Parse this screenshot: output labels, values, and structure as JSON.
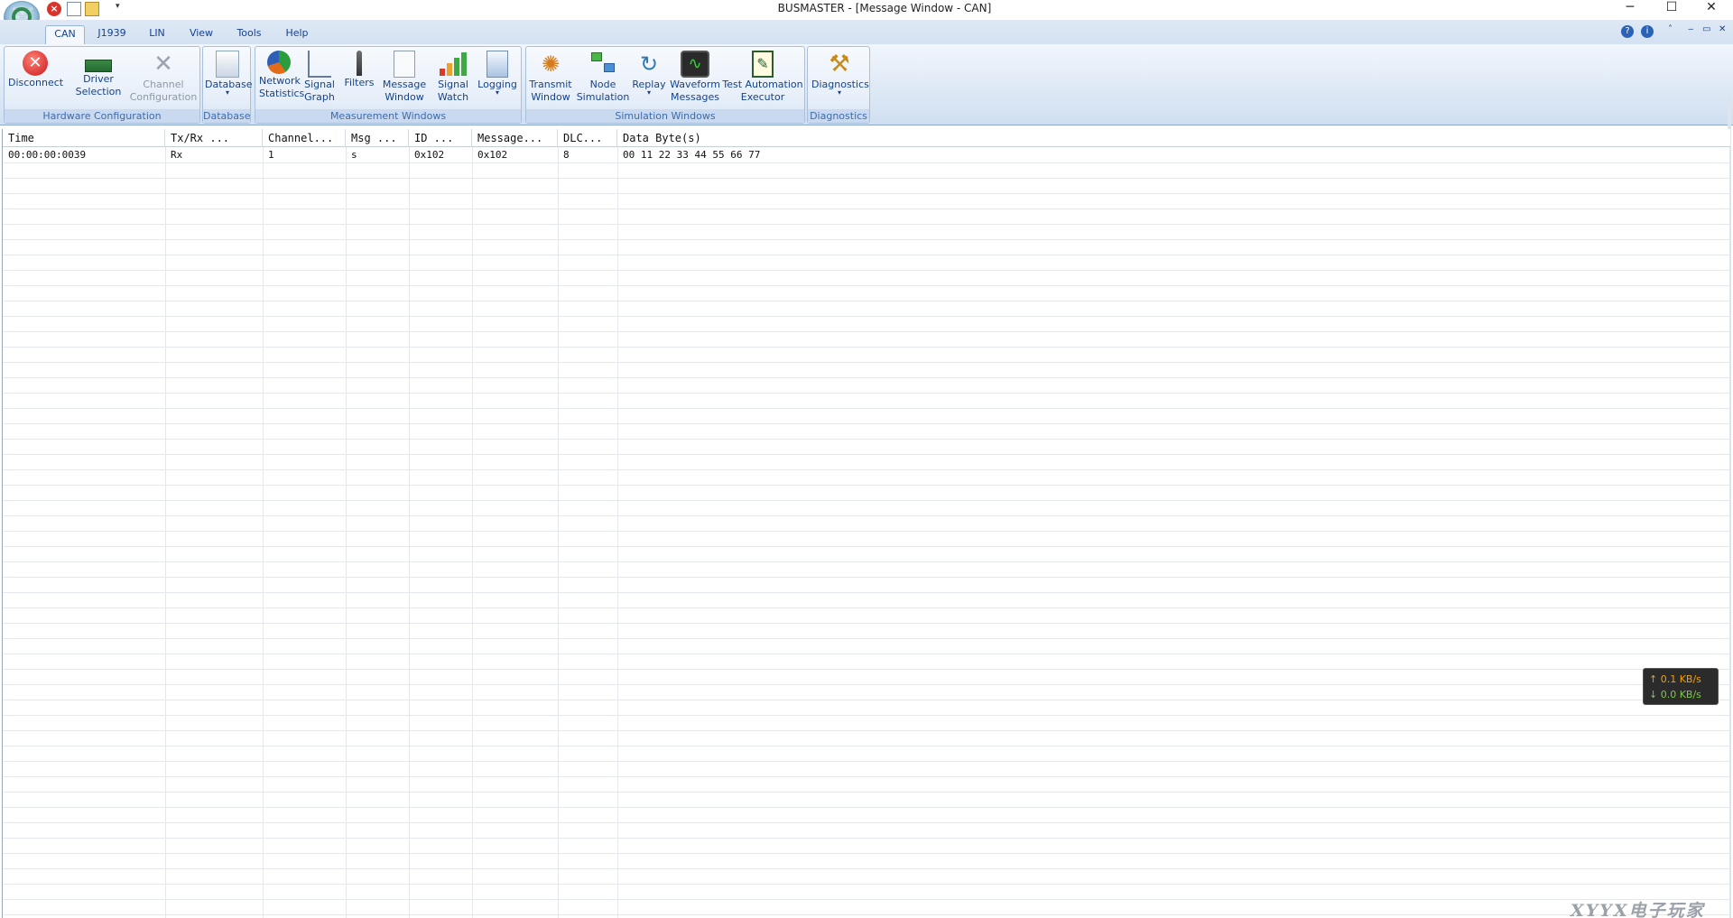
{
  "window": {
    "title": "BUSMASTER - [Message Window - CAN]",
    "minimize": "─",
    "maximize": "☐",
    "close": "✕"
  },
  "quick_access": {
    "more": "▾"
  },
  "tabs": [
    {
      "label": "CAN",
      "active": true
    },
    {
      "label": "J1939"
    },
    {
      "label": "LIN"
    },
    {
      "label": "View"
    },
    {
      "label": "Tools"
    },
    {
      "label": "Help"
    }
  ],
  "ribbon_controls": {
    "help": "?",
    "info": "i",
    "collapse": "˄",
    "mdi_min": "‒",
    "mdi_restore": "▭",
    "mdi_close": "✕"
  },
  "groups": {
    "hardware": {
      "label": "Hardware Configuration",
      "disconnect": "Disconnect",
      "driver_line1": "Driver",
      "driver_line2": "Selection",
      "channel_line1": "Channel",
      "channel_line2": "Configuration"
    },
    "database": {
      "label": "Database",
      "button": "Database"
    },
    "measurement": {
      "label": "Measurement Windows",
      "netstat_line1": "Network",
      "netstat_line2": "Statistics",
      "graph_line1": "Signal",
      "graph_line2": "Graph",
      "filters": "Filters",
      "msgwin_line1": "Message",
      "msgwin_line2": "Window",
      "watch_line1": "Signal",
      "watch_line2": "Watch",
      "logging": "Logging"
    },
    "simulation": {
      "label": "Simulation Windows",
      "tx_line1": "Transmit",
      "tx_line2": "Window",
      "node_line1": "Node",
      "node_line2": "Simulation",
      "replay": "Replay",
      "wave_line1": "Waveform",
      "wave_line2": "Messages",
      "test_line1": "Test Automation",
      "test_line2": "Executor"
    },
    "diagnostics": {
      "label": "Diagnostics",
      "button": "Diagnostics"
    }
  },
  "message_window": {
    "columns": [
      "Time",
      "Tx/Rx       ...",
      "Channel...",
      "Msg ...",
      "ID   ...",
      "Message...",
      "DLC...",
      "Data Byte(s)"
    ],
    "rows": [
      [
        "00:00:00:0039",
        "Rx",
        "1",
        "s",
        "0x102",
        "0x102",
        "8",
        "00 11 22 33 44 55 66 77"
      ]
    ]
  },
  "netspeed": {
    "up": "↑ 0.1 KB/s",
    "down": "↓ 0.0 KB/s"
  },
  "watermark": "XYYX电子玩家"
}
